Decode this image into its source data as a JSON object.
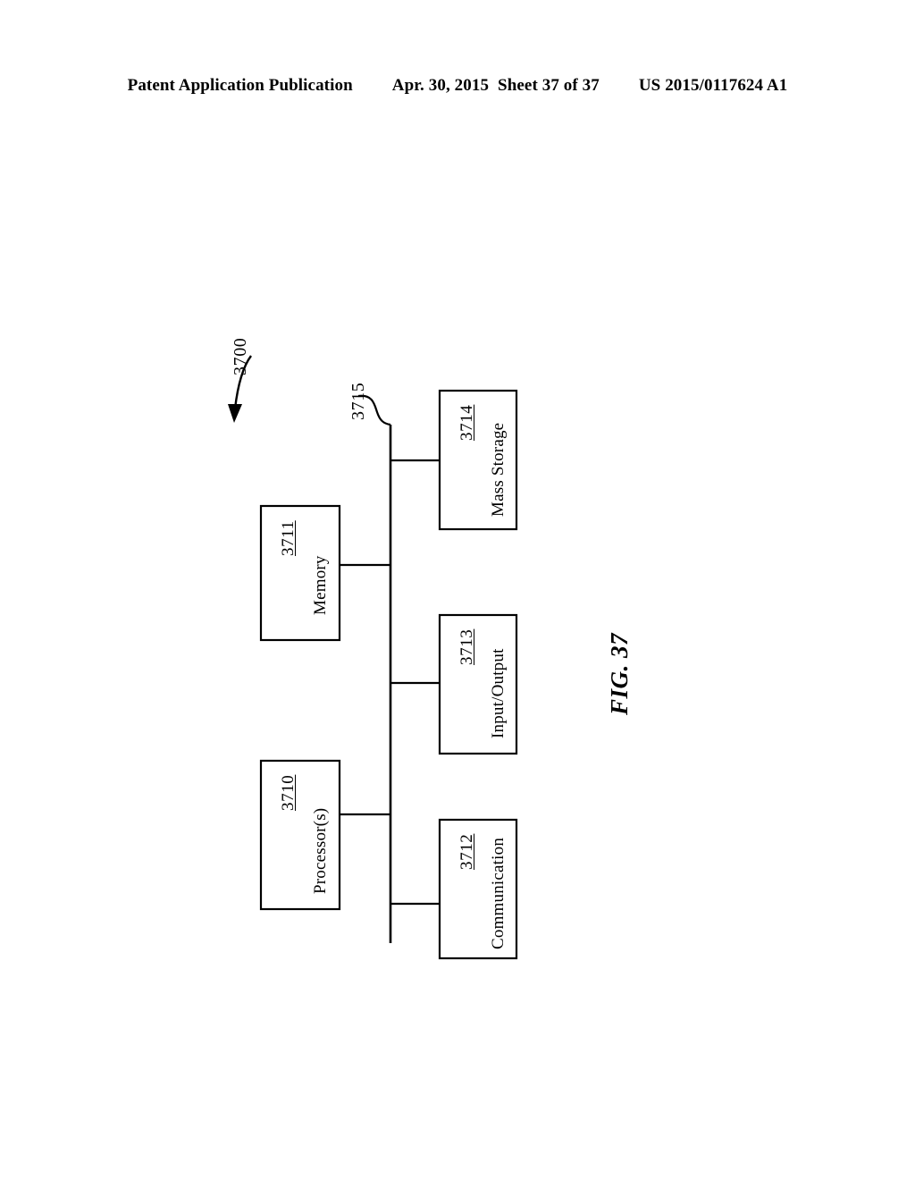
{
  "header": {
    "publication": "Patent Application Publication",
    "date": "Apr. 30, 2015",
    "sheet": "Sheet 37 of 37",
    "patent_number": "US 2015/0117624 A1"
  },
  "figure": {
    "caption": "FIG. 37",
    "system_ref": "3700",
    "bus_ref": "3715",
    "blocks": [
      {
        "label": "Memory",
        "ref": "3711"
      },
      {
        "label": "Processor(s)",
        "ref": "3710"
      },
      {
        "label": "Mass Storage",
        "ref": "3714"
      },
      {
        "label": "Input/Output",
        "ref": "3713"
      },
      {
        "label": "Communication",
        "ref": "3712"
      }
    ]
  },
  "colors": {
    "ink": "#000000",
    "paper": "#ffffff"
  }
}
